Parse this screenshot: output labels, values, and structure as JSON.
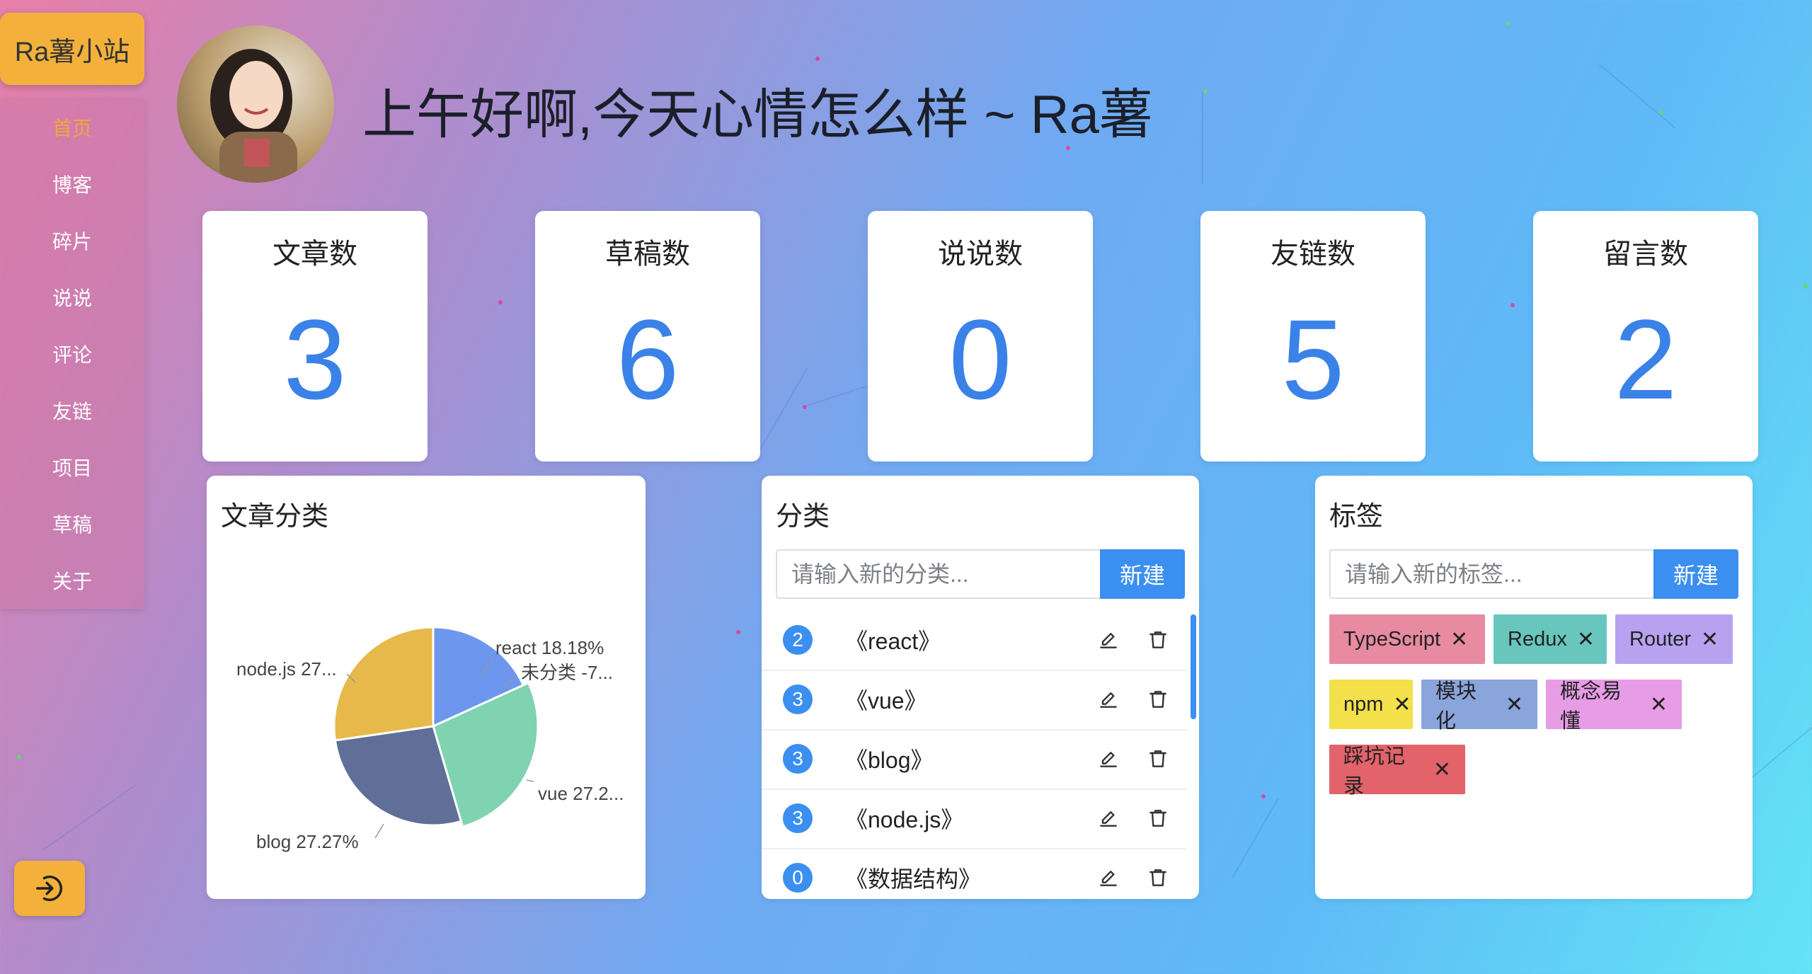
{
  "brand": "Ra薯小站",
  "nav": [
    "首页",
    "博客",
    "碎片",
    "说说",
    "评论",
    "友链",
    "项目",
    "草稿",
    "关于"
  ],
  "active_nav": "首页",
  "greeting": "上午好啊,今天心情怎么样 ~ Ra薯",
  "stats": [
    {
      "label": "文章数",
      "value": "3"
    },
    {
      "label": "草稿数",
      "value": "6"
    },
    {
      "label": "说说数",
      "value": "0"
    },
    {
      "label": "友链数",
      "value": "5"
    },
    {
      "label": "留言数",
      "value": "2"
    }
  ],
  "pie_card": {
    "title": "文章分类"
  },
  "chart_data": {
    "type": "pie",
    "categories": [
      "react",
      "vue",
      "blog",
      "node.js",
      "未分类"
    ],
    "values": [
      18.18,
      27.27,
      27.27,
      27.27,
      0
    ],
    "labels": [
      "react 18.18%",
      "vue 27.2...",
      "blog 27.27%",
      "node.js 27...",
      "未分类 -7..."
    ],
    "colors": [
      "#6d96ee",
      "#7fd3b0",
      "#5f6f97",
      "#e6b94a",
      "#e6b94a"
    ]
  },
  "categories_card": {
    "title": "分类",
    "placeholder": "请输入新的分类...",
    "button": "新建",
    "items": [
      {
        "count": "2",
        "name": "《react》"
      },
      {
        "count": "3",
        "name": "《vue》"
      },
      {
        "count": "3",
        "name": "《blog》"
      },
      {
        "count": "3",
        "name": "《node.js》"
      },
      {
        "count": "0",
        "name": "《数据结构》"
      }
    ]
  },
  "tags_card": {
    "title": "标签",
    "placeholder": "请输入新的标签...",
    "button": "新建",
    "tags": [
      {
        "name": "TypeScript",
        "color": "#e88ba0"
      },
      {
        "name": "Redux",
        "color": "#68c6bd"
      },
      {
        "name": "Router",
        "color": "#b8a2f0"
      },
      {
        "name": "npm",
        "color": "#f3e04a"
      },
      {
        "name": "模块化",
        "color": "#8aa4dc"
      },
      {
        "name": "概念易懂",
        "color": "#e79ce6"
      },
      {
        "name": "踩坑记录",
        "color": "#e2636a"
      }
    ]
  }
}
